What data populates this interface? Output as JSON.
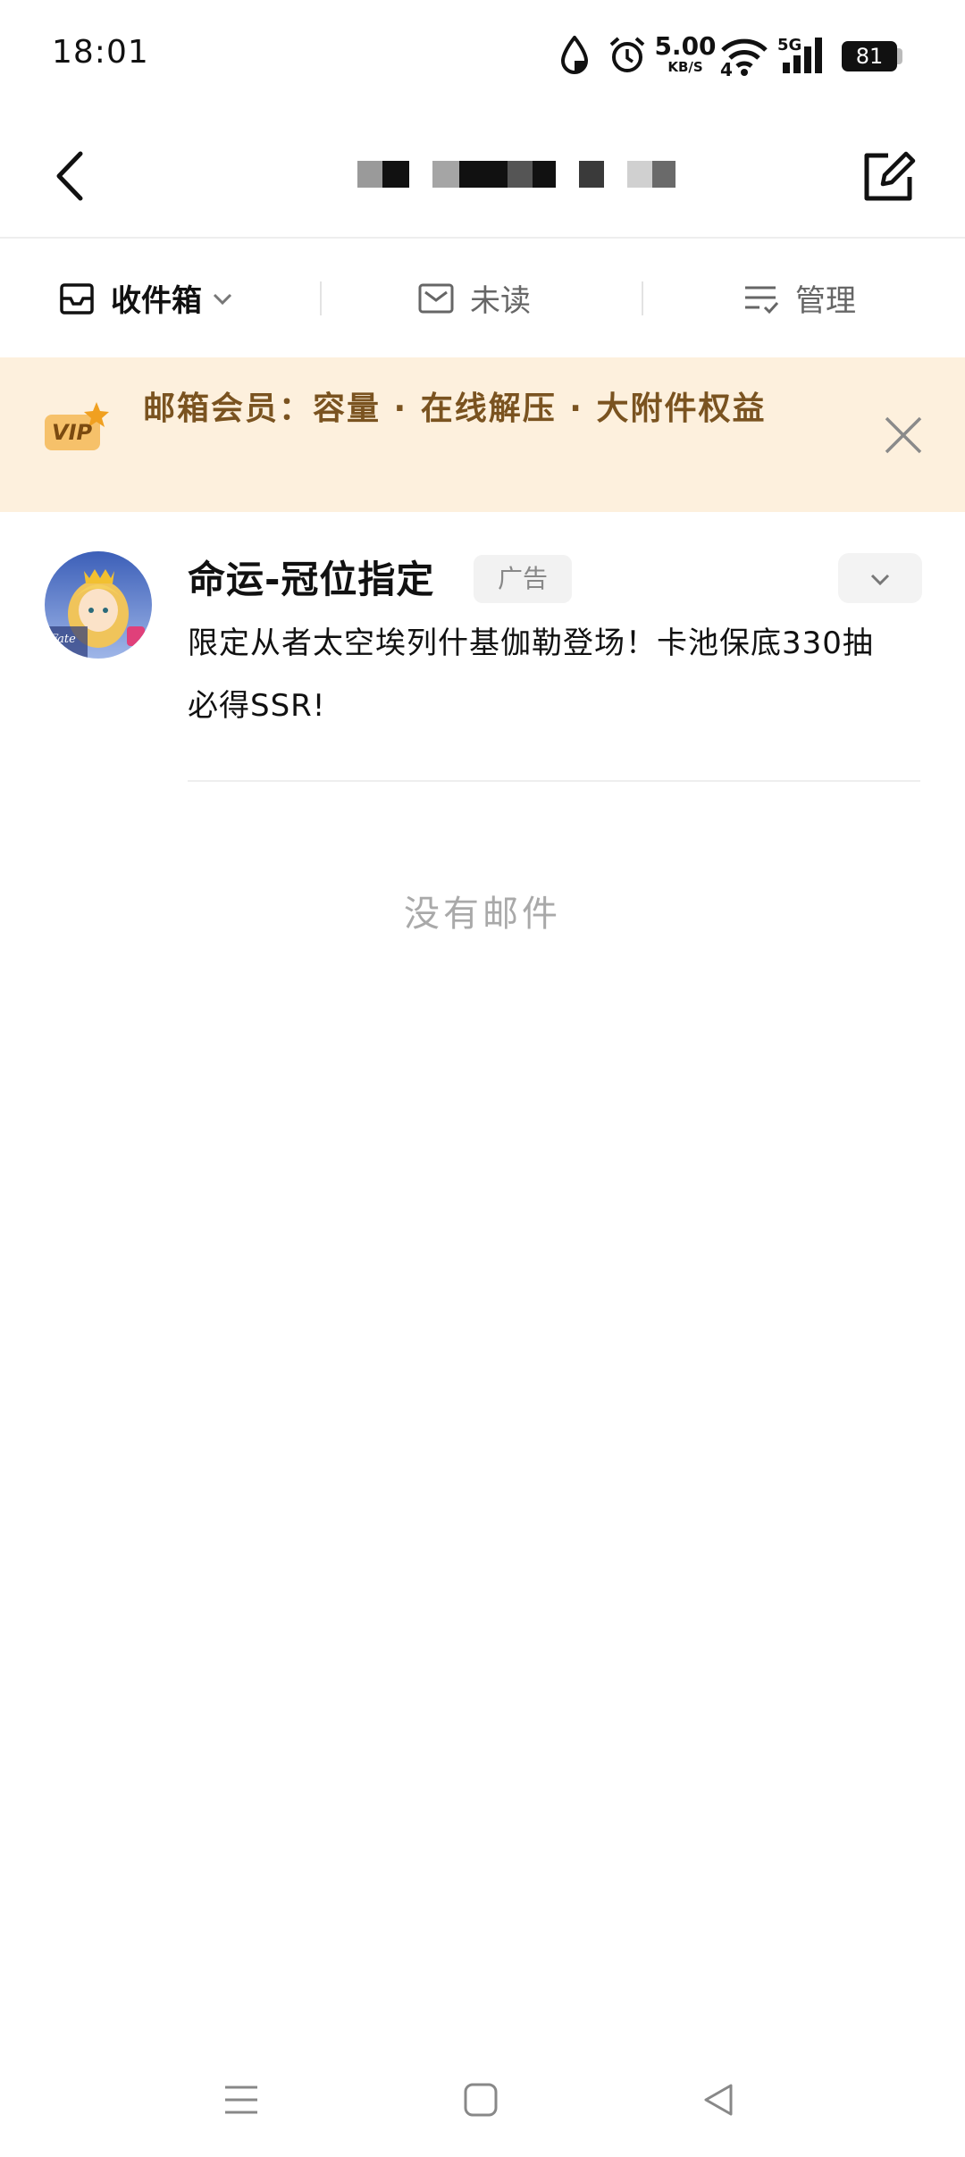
{
  "status_bar": {
    "time": "18:01",
    "network_speed_value": "5.00",
    "network_speed_unit": "KB/S",
    "network_type": "5G",
    "wifi_sub": "4",
    "battery": "81"
  },
  "header": {
    "back_icon": "chevron-left-icon",
    "compose_icon": "compose-edit-icon"
  },
  "filters": {
    "inbox_label": "收件箱",
    "unread_label": "未读",
    "manage_label": "管理"
  },
  "vip_banner": {
    "badge": "VIP",
    "text": "邮箱会员：容量 · 在线解压 · 大附件权益"
  },
  "mail_item": {
    "sender": "命运-冠位指定",
    "ad_label": "广告",
    "snippet": "限定从者太空埃列什基伽勒登场！卡池保底330抽必得SSR!"
  },
  "empty_state": {
    "text": "没有邮件"
  },
  "colors": {
    "banner_bg": "#fdf0dd",
    "banner_text": "#7a5320",
    "vip_gold": "#f0a020"
  }
}
